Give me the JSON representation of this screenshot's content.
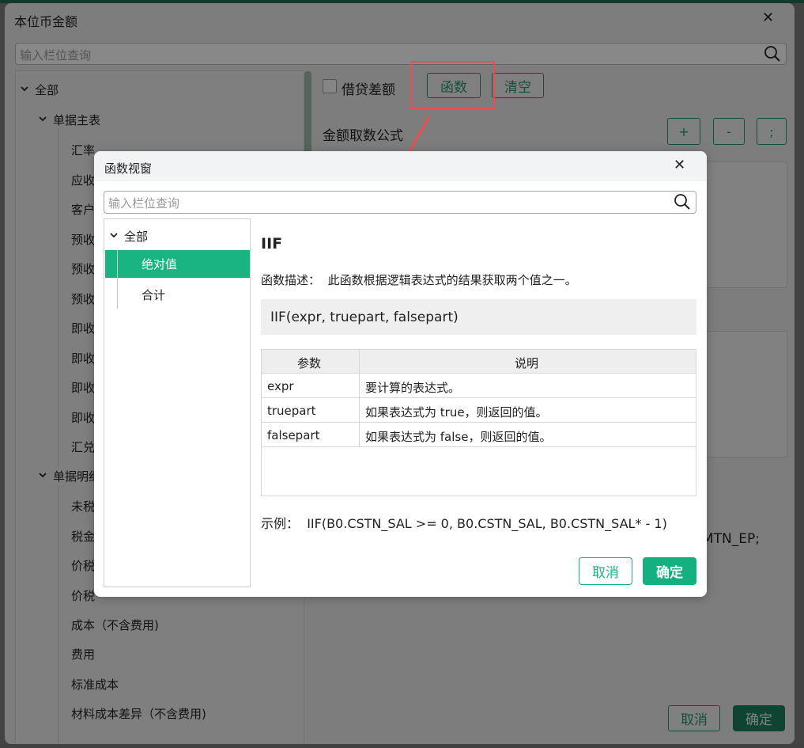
{
  "outer": {
    "title": "本位币金额",
    "search_placeholder": "输入栏位查询",
    "tree": {
      "root": "全部",
      "group1": "单据主表",
      "group1_items": [
        "汇率",
        "应收",
        "客户",
        "预收",
        "预收",
        "预收",
        "即收",
        "即收",
        "即收",
        "即收",
        "汇兑"
      ],
      "group2": "单据明细",
      "group2_items": [
        "未税",
        "税金",
        "价税",
        "价税",
        "成本（不含费用)",
        "费用",
        "标准成本",
        "材料成本差异（不含费用)"
      ]
    },
    "debit_credit_label": "借贷差额",
    "func_button": "函数",
    "clear_button": "清空",
    "formula_label": "金额取数公式",
    "op_plus": "+",
    "op_minus": "-",
    "op_semicolon": ";",
    "formula_fragment": "MTN_EP;",
    "cancel_button": "取消",
    "ok_button": "确定"
  },
  "modal": {
    "title": "函数视窗",
    "search_placeholder": "输入栏位查询",
    "tree": {
      "root": "全部",
      "items": [
        "绝对值",
        "合计"
      ]
    },
    "function_name": "IIF",
    "description_label": "函数描述：",
    "description_text": "此函数根据逻辑表达式的结果获取两个值之一。",
    "signature": "IIF(expr, truepart, falsepart)",
    "params_header": [
      "参数",
      "说明"
    ],
    "params": [
      {
        "name": "expr",
        "desc": "要计算的表达式。"
      },
      {
        "name": "truepart",
        "desc": "如果表达式为 true，则返回的值。"
      },
      {
        "name": "falsepart",
        "desc": "如果表达式为 false，则返回的值。"
      }
    ],
    "example_label": "示例：",
    "example_text": "IIF(B0.CSTN_SAL >= 0, B0.CSTN_SAL, B0.CSTN_SAL* - 1)",
    "cancel_button": "取消",
    "ok_button": "确定"
  },
  "colors": {
    "accent": "#1ab482",
    "highlight_box": "#e84f50"
  }
}
